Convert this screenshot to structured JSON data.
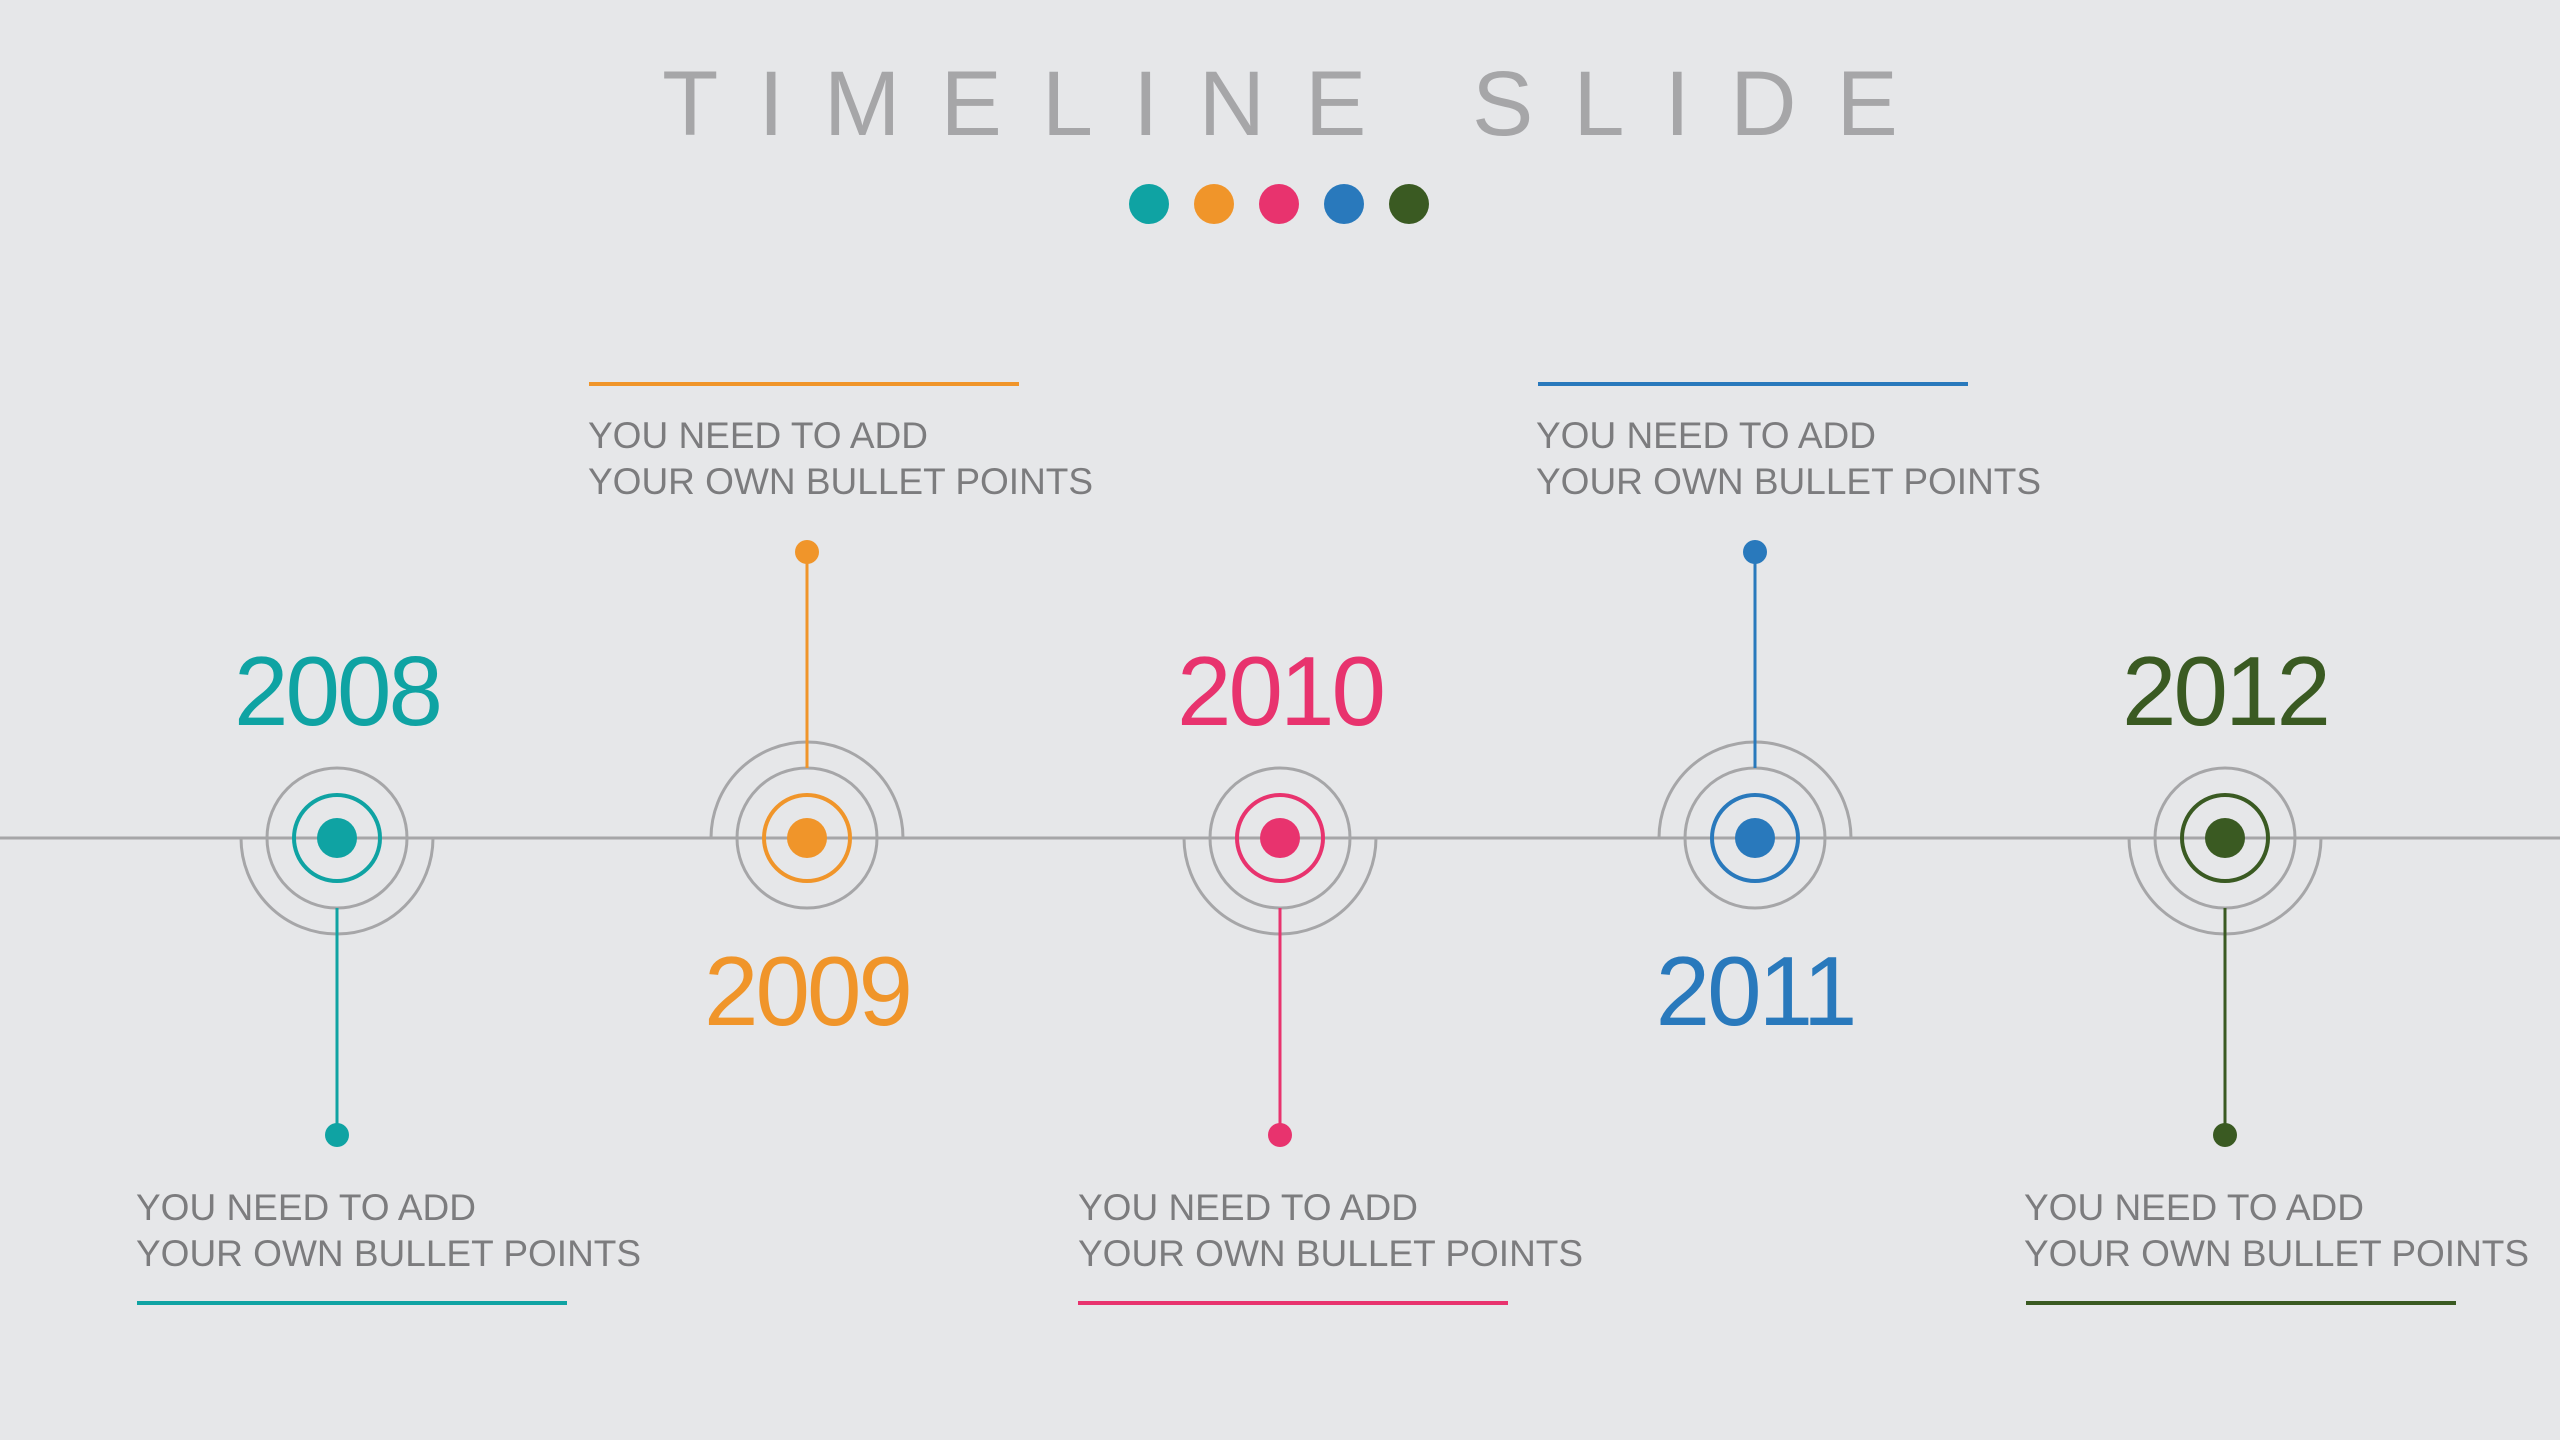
{
  "title": "TIMELINE SLIDE",
  "timeline_line_color": "#a6a6a8",
  "palette": [
    {
      "name": "teal",
      "color": "#0fa3a3"
    },
    {
      "name": "orange",
      "color": "#f0952a"
    },
    {
      "name": "pink",
      "color": "#e8336e"
    },
    {
      "name": "blue",
      "color": "#2979bc"
    },
    {
      "name": "dark-green",
      "color": "#3a5a22"
    }
  ],
  "milestones": [
    {
      "year": "2008",
      "color": "#0fa3a3",
      "text_line1": "YOU NEED TO ADD",
      "text_line2": "YOUR OWN BULLET POINTS"
    },
    {
      "year": "2009",
      "color": "#f0952a",
      "text_line1": "YOU NEED TO ADD",
      "text_line2": "YOUR OWN BULLET POINTS"
    },
    {
      "year": "2010",
      "color": "#e8336e",
      "text_line1": "YOU NEED TO ADD",
      "text_line2": "YOUR OWN BULLET POINTS"
    },
    {
      "year": "2011",
      "color": "#2979bc",
      "text_line1": "YOU NEED TO ADD",
      "text_line2": "YOUR OWN BULLET POINTS"
    },
    {
      "year": "2012",
      "color": "#3a5a22",
      "text_line1": "YOU NEED TO ADD",
      "text_line2": "YOUR OWN BULLET POINTS"
    }
  ]
}
